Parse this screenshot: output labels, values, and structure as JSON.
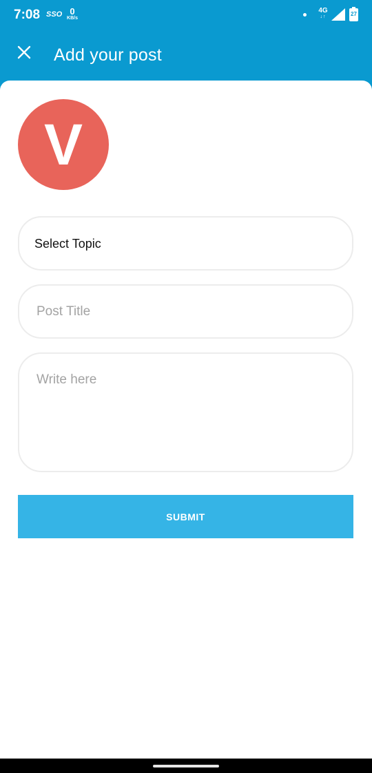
{
  "status_bar": {
    "time": "7:08",
    "sso": "SSO",
    "data_speed": "0",
    "data_unit": "KB/s",
    "network": "4G",
    "network_arrows": "↓↑",
    "battery": "27"
  },
  "app_bar": {
    "close_icon": "close-icon",
    "title": "Add your post"
  },
  "avatar": {
    "letter": "V",
    "color": "#e8645a"
  },
  "form": {
    "topic_label": "Select Topic",
    "title_placeholder": "Post Title",
    "body_placeholder": "Write here",
    "submit_label": "SUBMIT"
  },
  "colors": {
    "primary": "#0a9ad0",
    "button": "#35b4e6"
  }
}
